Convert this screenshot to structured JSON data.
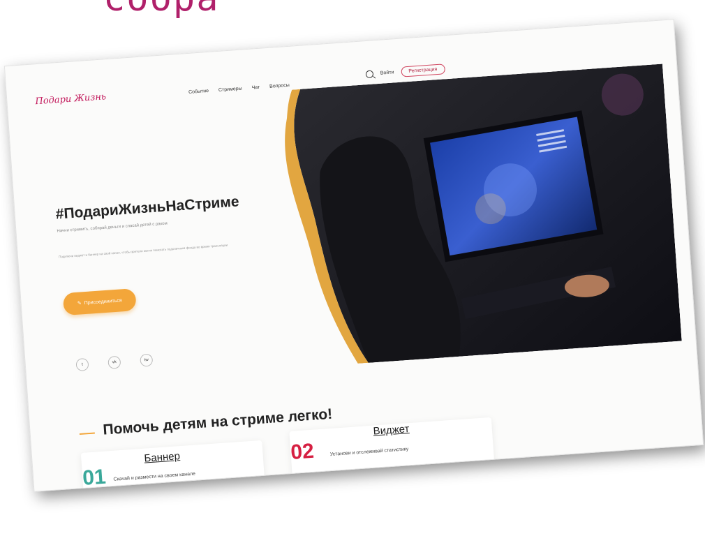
{
  "slide": {
    "title": "сбора"
  },
  "site": {
    "logo": "Подари Жизнь",
    "nav": [
      "Событие",
      "Стримеры",
      "Чат",
      "Вопросы"
    ],
    "login": "Войти",
    "register": "Регистрация"
  },
  "hero": {
    "title": "#ПодариЖизньНаСтриме",
    "subtitle": "Начни стримить, собирай деньги и спасай детей с раком",
    "description": "Подключи виджет и баннер на свой канал, чтобы зрители могли помогать подопечным фонда во время трансляции",
    "cta": "Присоединиться",
    "cta_icon": "pencil-icon"
  },
  "socials": [
    {
      "icon": "twitter-icon",
      "glyph": "t"
    },
    {
      "icon": "vk-icon",
      "glyph": "vk"
    },
    {
      "icon": "twitch-icon",
      "glyph": "tw"
    }
  ],
  "section": {
    "title": "Помочь детям на стриме легко!"
  },
  "steps": [
    {
      "num": "01",
      "title": "Баннер",
      "desc": "Скачай и размести на своем канале",
      "color": "#3aa89a"
    },
    {
      "num": "02",
      "title": "Виджет",
      "desc": "Установи и отслеживай статистику",
      "color": "#d62042"
    }
  ],
  "colors": {
    "accent": "#f3a63a",
    "brand": "#c2185b"
  }
}
